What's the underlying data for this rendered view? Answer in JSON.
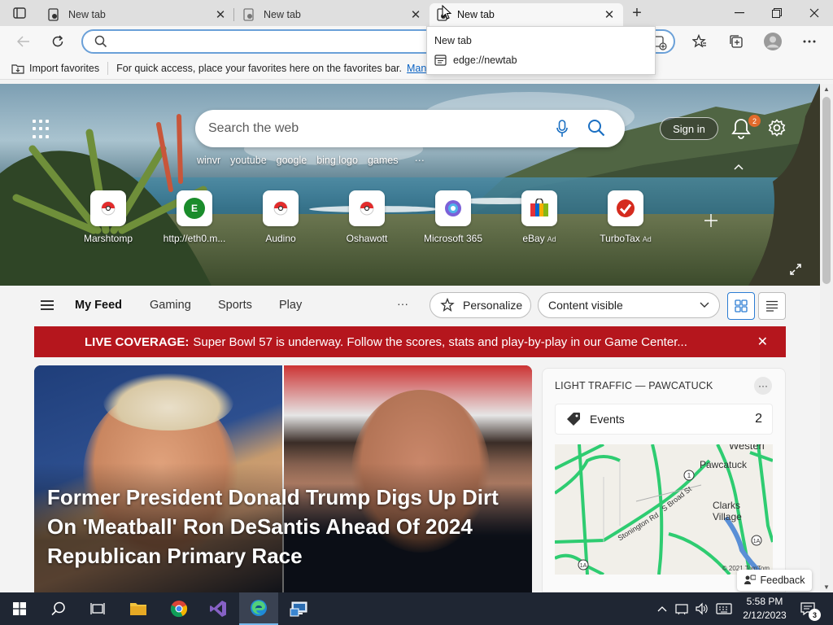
{
  "browser": {
    "tabs": [
      {
        "title": "New tab",
        "active": false
      },
      {
        "title": "New tab",
        "active": false
      },
      {
        "title": "New tab",
        "active": true
      }
    ],
    "address": {
      "value": "",
      "placeholder": ""
    },
    "dropdown": {
      "title": "New tab",
      "item_label": "edge://newtab"
    },
    "favorites_bar": {
      "import_label": "Import favorites",
      "hint": "For quick access, place your favorites here on the favorites bar.",
      "manage_link": "Manag"
    }
  },
  "hero": {
    "search_placeholder": "Search the web",
    "trending": [
      "winvr",
      "youtube",
      "google",
      "bing logo",
      "games"
    ],
    "trending_more": "···",
    "signin_label": "Sign in",
    "notification_count": "2",
    "tiles": [
      {
        "label": "Marshtomp",
        "icon": "pokeball-icon",
        "ad": ""
      },
      {
        "label": "http://eth0.m...",
        "icon": "letter-e-icon",
        "ad": ""
      },
      {
        "label": "Audino",
        "icon": "pokeball-icon",
        "ad": ""
      },
      {
        "label": "Oshawott",
        "icon": "pokeball-icon",
        "ad": ""
      },
      {
        "label": "Microsoft 365",
        "icon": "m365-icon",
        "ad": ""
      },
      {
        "label": "eBay",
        "icon": "ebay-bag-icon",
        "ad": "Ad"
      },
      {
        "label": "TurboTax",
        "icon": "turbotax-check-icon",
        "ad": "Ad"
      }
    ],
    "tile_letter": "E"
  },
  "feed_nav": {
    "tabs": [
      "My Feed",
      "Gaming",
      "Sports",
      "Play"
    ],
    "more": "···",
    "personalize_label": "Personalize",
    "content_select": "Content visible"
  },
  "banner": {
    "lead": "LIVE COVERAGE:",
    "text": "Super Bowl 57 is underway. Follow the scores, stats and play-by-play in our Game Center..."
  },
  "article": {
    "headline": "Former President Donald Trump Digs Up Dirt On 'Meatball' Ron DeSantis Ahead Of 2024 Republican Primary Race"
  },
  "traffic": {
    "title": "LIGHT TRAFFIC — PAWCATUCK",
    "more": "···",
    "events_label": "Events",
    "events_count": "2",
    "map_labels": [
      "Westerl",
      "Pawcatuck",
      "Clarks Village",
      "Stonington Rd",
      "S Broad St"
    ],
    "map_shields": [
      "1",
      "1A",
      "1A"
    ],
    "map_copyright": "© 2021 TomTom"
  },
  "feedback_label": "Feedback",
  "taskbar": {
    "time": "5:58 PM",
    "date": "2/12/2023",
    "notifications": "3"
  },
  "colors": {
    "banner": "#b5161d",
    "accent": "#2b7cd3",
    "traffic_green": "#2ecc71",
    "taskbar": "#1f2633"
  }
}
